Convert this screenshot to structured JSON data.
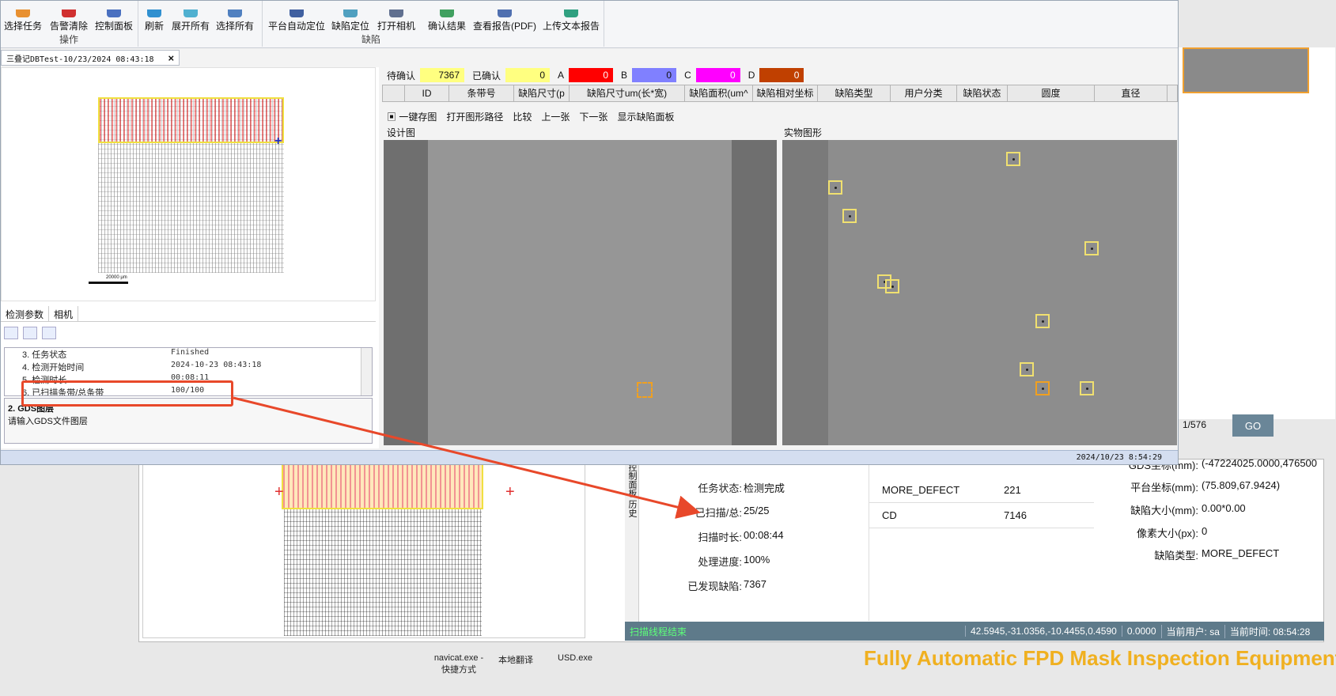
{
  "ribbon": {
    "buttons": [
      "选择任务",
      "告警清除",
      "控制面板",
      "刷新",
      "展开所有",
      "选择所有",
      "平台自动定位",
      "缺陷定位",
      "打开相机",
      "确认结果",
      "查看报告(PDF)",
      "上传文本报告"
    ],
    "groups": [
      "操作",
      "缺陷"
    ]
  },
  "doc_tab": {
    "title": "三叠记DBTest-10/23/2024 08:43:18",
    "close": "×"
  },
  "map": {
    "scale_label": "20000 μm"
  },
  "param_tabs": [
    "检测参数",
    "相机"
  ],
  "params": [
    {
      "key": "3. 任务状态",
      "value": "Finished"
    },
    {
      "key": "4. 检测开始时间",
      "value": "2024-10-23 08:43:18"
    },
    {
      "key": "5. 检测时长",
      "value": "00:08:11"
    },
    {
      "key": "6. 已扫描条带/总条带",
      "value": "100/100"
    }
  ],
  "param_desc": {
    "title": "2. GDS图层",
    "text": "请输入GDS文件图层"
  },
  "counters": {
    "pending_label": "待确认",
    "pending_value": "7367",
    "confirmed_label": "已确认",
    "confirmed_value": "0",
    "a_label": "A",
    "a_value": "0",
    "b_label": "B",
    "b_value": "0",
    "c_label": "C",
    "c_value": "0",
    "d_label": "D",
    "d_value": "0",
    "colors": {
      "pending": "#ffff80",
      "confirmed": "#ffff80",
      "a": "#ff0000",
      "b": "#8080ff",
      "c": "#ff00ff",
      "d": "#c04000"
    }
  },
  "table_headers": [
    "ID",
    "条带号",
    "缺陷尺寸(p",
    "缺陷尺寸um(长*宽)",
    "缺陷面积(um^",
    "缺陷相对坐标",
    "缺陷类型",
    "用户分类",
    "缺陷状态",
    "圆度",
    "直径"
  ],
  "image_toolbar": [
    "一键存图",
    "打开图形路径",
    "比较",
    "上一张",
    "下一张",
    "显示缺陷面板"
  ],
  "image_labels": {
    "design": "设计图",
    "real": "实物图形"
  },
  "main_status_time": "2024/10/23 8:54:29",
  "bg": {
    "vtabs": "控制面板 历史",
    "info": [
      {
        "key": "任务状态:",
        "value": "检测完成"
      },
      {
        "key": "已扫描/总:",
        "value": "25/25"
      },
      {
        "key": "扫描时长:",
        "value": "00:08:44"
      },
      {
        "key": "处理进度:",
        "value": "100%"
      },
      {
        "key": "已发现缺陷:",
        "value": "7367"
      }
    ],
    "defect_table": [
      {
        "type": "MORE_DEFECT",
        "count": "221"
      },
      {
        "type": "CD",
        "count": "7146"
      }
    ],
    "detail": [
      {
        "key": "GDS坐标(mm):",
        "value": "(-47224025.0000,476500"
      },
      {
        "key": "平台坐标(mm):",
        "value": "(75.809,67.9424)"
      },
      {
        "key": "缺陷大小(mm):",
        "value": "0.00*0.00"
      },
      {
        "key": "像素大小(px):",
        "value": "0"
      },
      {
        "key": "缺陷类型:",
        "value": "MORE_DEFECT"
      }
    ],
    "page": "1/576",
    "go": "GO",
    "status": {
      "left": "扫描线程结束",
      "coords": "42.5945,-31.0356,-10.4455,0.4590",
      "value": "0.0000",
      "user": "当前用户: sa",
      "time": "当前时间: 08:54:28"
    }
  },
  "desktop_icons": [
    "navicat.exe - 快捷方式",
    "本地翻译",
    "USD.exe"
  ],
  "brand": "Fully Automatic FPD Mask Inspection Equipment"
}
